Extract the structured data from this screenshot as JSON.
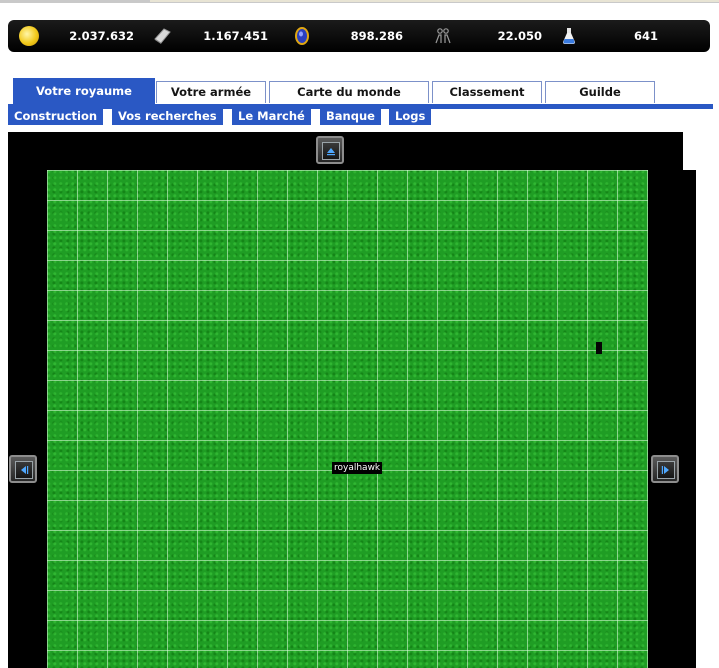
{
  "resources": {
    "gold": "2.037.632",
    "iron": "1.167.451",
    "gem": "898.286",
    "population": "22.050",
    "potion": "641"
  },
  "icons": [
    "coin-icon",
    "iron-ingot-icon",
    "gem-icon",
    "population-icon",
    "potion-icon"
  ],
  "tabs": [
    {
      "label": "Votre royaume",
      "active": true
    },
    {
      "label": "Votre armée"
    },
    {
      "label": "Carte du monde"
    },
    {
      "label": "Classement"
    },
    {
      "label": "Guilde"
    }
  ],
  "subtabs": [
    "Construction",
    "Vos recherches",
    "Le Marché",
    "Banque",
    "Logs"
  ],
  "map": {
    "player_name": "royalhawk"
  },
  "colors": {
    "tab_blue": "#2a58c4",
    "grass": "#1f9d24"
  }
}
